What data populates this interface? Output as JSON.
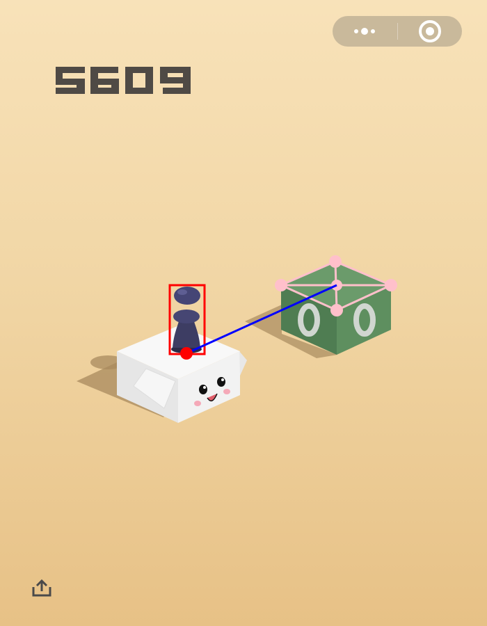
{
  "game": {
    "score": "5609"
  },
  "capsule": {
    "more_icon": "more-dots-icon",
    "close_icon": "close-target-icon"
  },
  "share": {
    "icon": "share-upload-icon"
  },
  "colors": {
    "background_top": "#f8e2b9",
    "background_bottom": "#e7c186",
    "score_digits": "#4f4a45",
    "capsule_bg": "#c9b99b",
    "start_block_top": "#f5f5f5",
    "target_block_top": "#6a9a6a",
    "bounding_box": "#ff0000",
    "aim_line": "#0000ff",
    "target_marker": "#ffc0cb",
    "player_piece": "#3a3a5c"
  }
}
